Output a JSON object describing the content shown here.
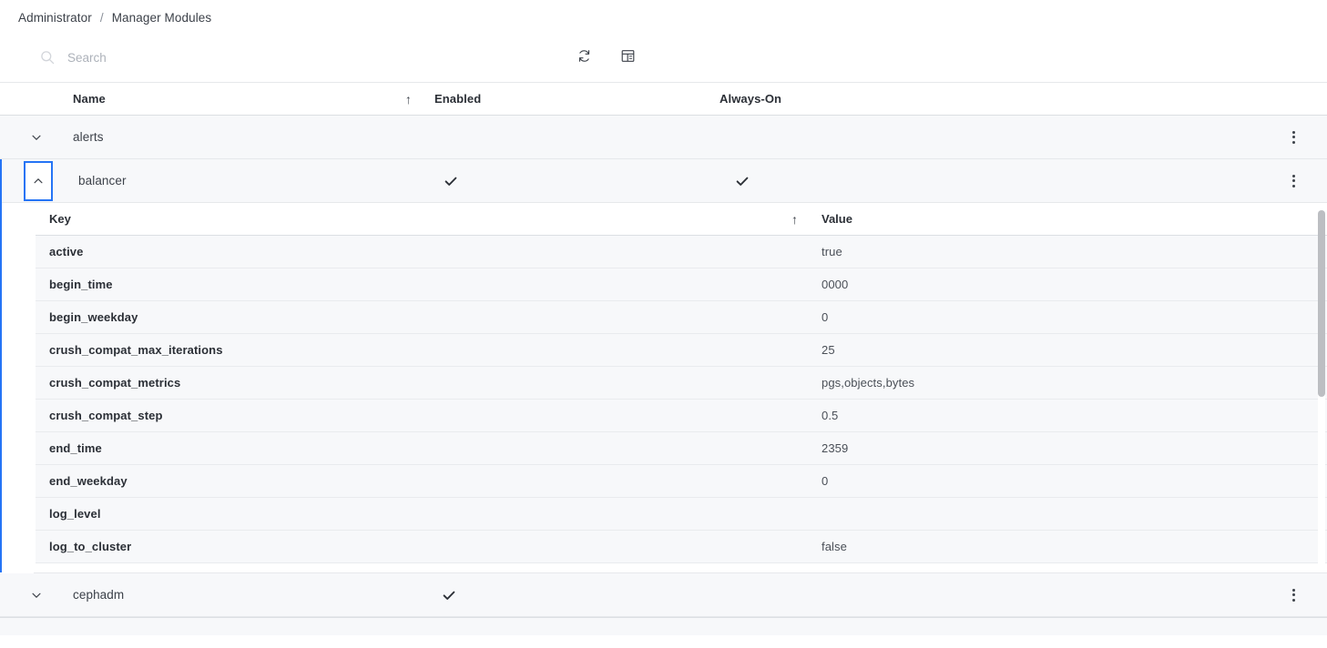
{
  "breadcrumb": {
    "items": [
      "Administrator",
      "Manager Modules"
    ],
    "separator": "/"
  },
  "toolbar": {
    "search": {
      "value": "",
      "placeholder": "Search",
      "icon": "search-icon"
    },
    "buttons": [
      {
        "name": "refresh-button",
        "icon": "refresh-icon",
        "label": ""
      },
      {
        "name": "table-settings-button",
        "icon": "table-settings-icon",
        "label": ""
      }
    ]
  },
  "table": {
    "columns": [
      {
        "label": "Name",
        "sort": "asc",
        "sort_glyph": "↑"
      },
      {
        "label": "Enabled",
        "sort": "none"
      },
      {
        "label": "Always-On",
        "sort": "none"
      }
    ],
    "rows": [
      {
        "name": "alerts",
        "enabled": false,
        "always_on": false,
        "expanded": false,
        "chevron": "⌄"
      },
      {
        "name": "balancer",
        "enabled": true,
        "always_on": true,
        "expanded": true,
        "chevron": "⌃"
      },
      {
        "name": "cephadm",
        "enabled": true,
        "always_on": false,
        "expanded": false,
        "chevron": "⌄"
      }
    ],
    "check_glyph": "✔"
  },
  "detail": {
    "module": "balancer",
    "columns": [
      {
        "label": "Key",
        "sort": "asc",
        "sort_glyph": "↑"
      },
      {
        "label": "Value",
        "sort": "none"
      }
    ],
    "rows": [
      {
        "key": "active",
        "value": "true"
      },
      {
        "key": "begin_time",
        "value": "0000"
      },
      {
        "key": "begin_weekday",
        "value": "0"
      },
      {
        "key": "crush_compat_max_iterations",
        "value": "25"
      },
      {
        "key": "crush_compat_metrics",
        "value": "pgs,objects,bytes"
      },
      {
        "key": "crush_compat_step",
        "value": "0.5"
      },
      {
        "key": "end_time",
        "value": "2359"
      },
      {
        "key": "end_weekday",
        "value": "0"
      },
      {
        "key": "log_level",
        "value": ""
      },
      {
        "key": "log_to_cluster",
        "value": "false"
      }
    ],
    "scrollbar": {
      "visible": true
    }
  },
  "colors": {
    "accent": "#2574f5",
    "row_bg": "#f7f8fa",
    "text": "#2b2f36",
    "muted": "#adb2ba",
    "border": "#e6e8eb"
  }
}
